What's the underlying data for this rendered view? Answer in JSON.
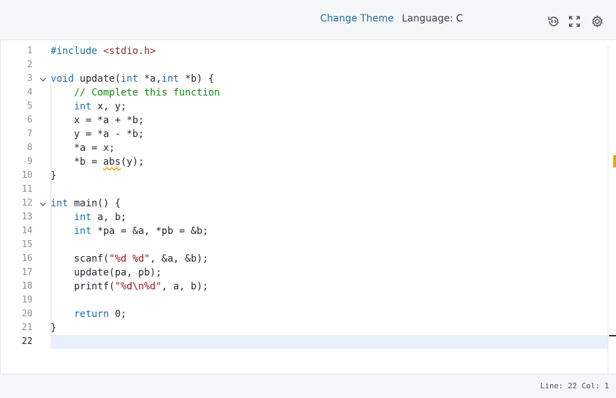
{
  "toolbar": {
    "change_theme_label": "Change Theme",
    "language_label": "Language:",
    "language_value": "C",
    "icons": [
      "history-reset-icon",
      "fullscreen-icon",
      "gear-icon"
    ]
  },
  "editor": {
    "line_numbers": [
      "1",
      "2",
      "3",
      "4",
      "5",
      "6",
      "7",
      "8",
      "9",
      "10",
      "11",
      "12",
      "13",
      "14",
      "15",
      "16",
      "17",
      "18",
      "19",
      "20",
      "21",
      "22"
    ],
    "lines": {
      "l1": {
        "a": "#include ",
        "b": "<stdio.h>"
      },
      "l3": {
        "a": "void",
        "b": " update(",
        "c": "int",
        "d": " *a,",
        "e": "int",
        "f": " *b) {"
      },
      "l4": {
        "a": "    ",
        "b": "// Complete this function"
      },
      "l5": {
        "a": "    ",
        "b": "int",
        "c": " x, y;"
      },
      "l6": {
        "a": "    x = *a + *b;"
      },
      "l7": {
        "a": "    y = *a - *b;"
      },
      "l8": {
        "a": "    *a = x;"
      },
      "l9": {
        "a": "    *b = ",
        "b": "abs",
        "c": "(y);"
      },
      "l10": {
        "a": "}"
      },
      "l12": {
        "a": "int",
        "b": " main() {"
      },
      "l13": {
        "a": "    ",
        "b": "int",
        "c": " a, b;"
      },
      "l14": {
        "a": "    ",
        "b": "int",
        "c": " *pa = &a, *pb = &b;"
      },
      "l16": {
        "a": "    scanf(",
        "b": "\"%d %d\"",
        "c": ", &a, &b);"
      },
      "l17": {
        "a": "    update(pa, pb);"
      },
      "l18": {
        "a": "    printf(",
        "b": "\"%d\\n%d\"",
        "c": ", a, b);"
      },
      "l20": {
        "a": "    ",
        "b": "return",
        "c": " 0;"
      },
      "l21": {
        "a": "}"
      }
    },
    "current_line": 22
  },
  "status": {
    "position_text": "Line: 22 Col: 1"
  },
  "colors": {
    "keyword": "#1f6fa8",
    "string": "#a31515",
    "comment": "#138a0e",
    "warning_marker": "#e8a800",
    "current_line_bg": "#e8f1fb"
  }
}
